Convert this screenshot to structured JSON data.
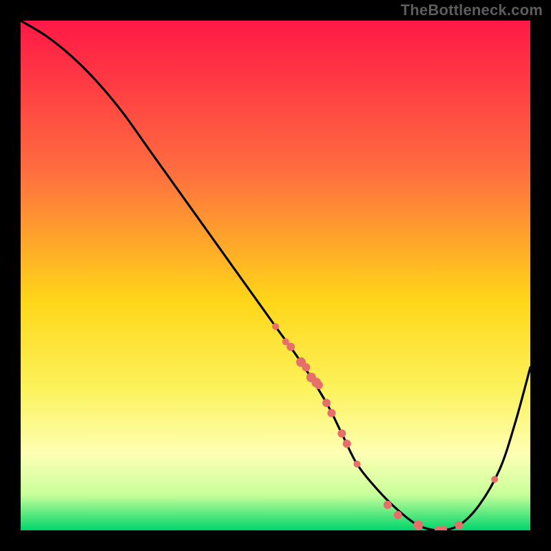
{
  "watermark": "TheBottleneck.com",
  "chart_data": {
    "type": "line",
    "title": "",
    "xlabel": "",
    "ylabel": "",
    "xlim": [
      0,
      100
    ],
    "ylim": [
      0,
      100
    ],
    "gradient_stops": [
      {
        "pos": 0.0,
        "color": "#ff1846"
      },
      {
        "pos": 0.3,
        "color": "#ff6f3f"
      },
      {
        "pos": 0.55,
        "color": "#ffd618"
      },
      {
        "pos": 0.72,
        "color": "#fcf25b"
      },
      {
        "pos": 0.85,
        "color": "#feffb4"
      },
      {
        "pos": 0.93,
        "color": "#c8ff9a"
      },
      {
        "pos": 1.0,
        "color": "#00d66b"
      }
    ],
    "series": [
      {
        "name": "curve",
        "x": [
          0,
          5,
          10,
          15,
          20,
          25,
          30,
          35,
          40,
          45,
          50,
          55,
          60,
          63,
          66,
          70,
          74,
          78,
          82,
          86,
          90,
          94,
          97,
          100
        ],
        "y": [
          100,
          97,
          93,
          88,
          82,
          75,
          68,
          61,
          54,
          47,
          40,
          33,
          25,
          19,
          13,
          8,
          4,
          1,
          0,
          1,
          5,
          12,
          21,
          32
        ]
      }
    ],
    "markers": {
      "name": "points",
      "color": "#e76f6a",
      "x": [
        50,
        52,
        53,
        55,
        56,
        57,
        58,
        58.5,
        60,
        61,
        63,
        64,
        66,
        72,
        74,
        78,
        82,
        83,
        86,
        93
      ],
      "y": [
        40,
        37,
        36,
        33,
        32,
        30,
        29,
        28.5,
        25,
        23,
        19,
        17,
        13,
        5,
        3,
        1,
        0,
        0.2,
        1,
        10
      ],
      "r": [
        5,
        5,
        6,
        7,
        6,
        7,
        7,
        6,
        6,
        6,
        6,
        6,
        5,
        6,
        6,
        7,
        6,
        5,
        6,
        5
      ]
    }
  }
}
